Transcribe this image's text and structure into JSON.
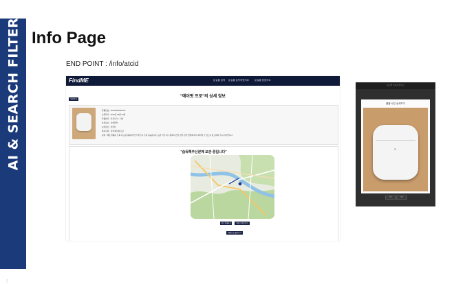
{
  "sidebar": {
    "title": "AI & SEARCH FILTER",
    "page_number": "5"
  },
  "page": {
    "title": "Info Page",
    "endpoint": "END POINT : /info/atcid"
  },
  "screenshot": {
    "logo": "FindME",
    "nav": [
      "분실물 검색",
      "분실물 습득하였어요",
      "분실물 찾았어요"
    ],
    "detail_heading": "\"에어팟 프로\"의 상세 정보",
    "back_button": "뒤로가기",
    "info_lines": [
      "물품번호 : 20230504000012",
      "습득일자 : 2023년 05월 04일",
      "물품분류 : 전자기기 > 기타",
      "습득장소 : 지하철역",
      "보관장소 : 경찰서",
      "특이사항 : 흰색 에어팟 프로",
      "상세 : 해당 물품은 습득 후 보관 중이며 본인 확인 후 수령 가능합니다. 보관 기간 내 수령하지 않을 경우 관련 법령에 따라 처리될 수 있으니 참고하여 주시기 바랍니다."
    ],
    "map_title": "\"습득해주신분께 보관 중입니다\"",
    "map_buttons": [
      "지도 확대하기",
      "길찾기 바로가기"
    ],
    "bottom_button": "메인으로 돌아가기"
  },
  "phone": {
    "header": "분실물 습득하였어요",
    "modal_title": "물품 사진 상세보기",
    "buttons": [
      "닫기",
      "저장"
    ]
  }
}
